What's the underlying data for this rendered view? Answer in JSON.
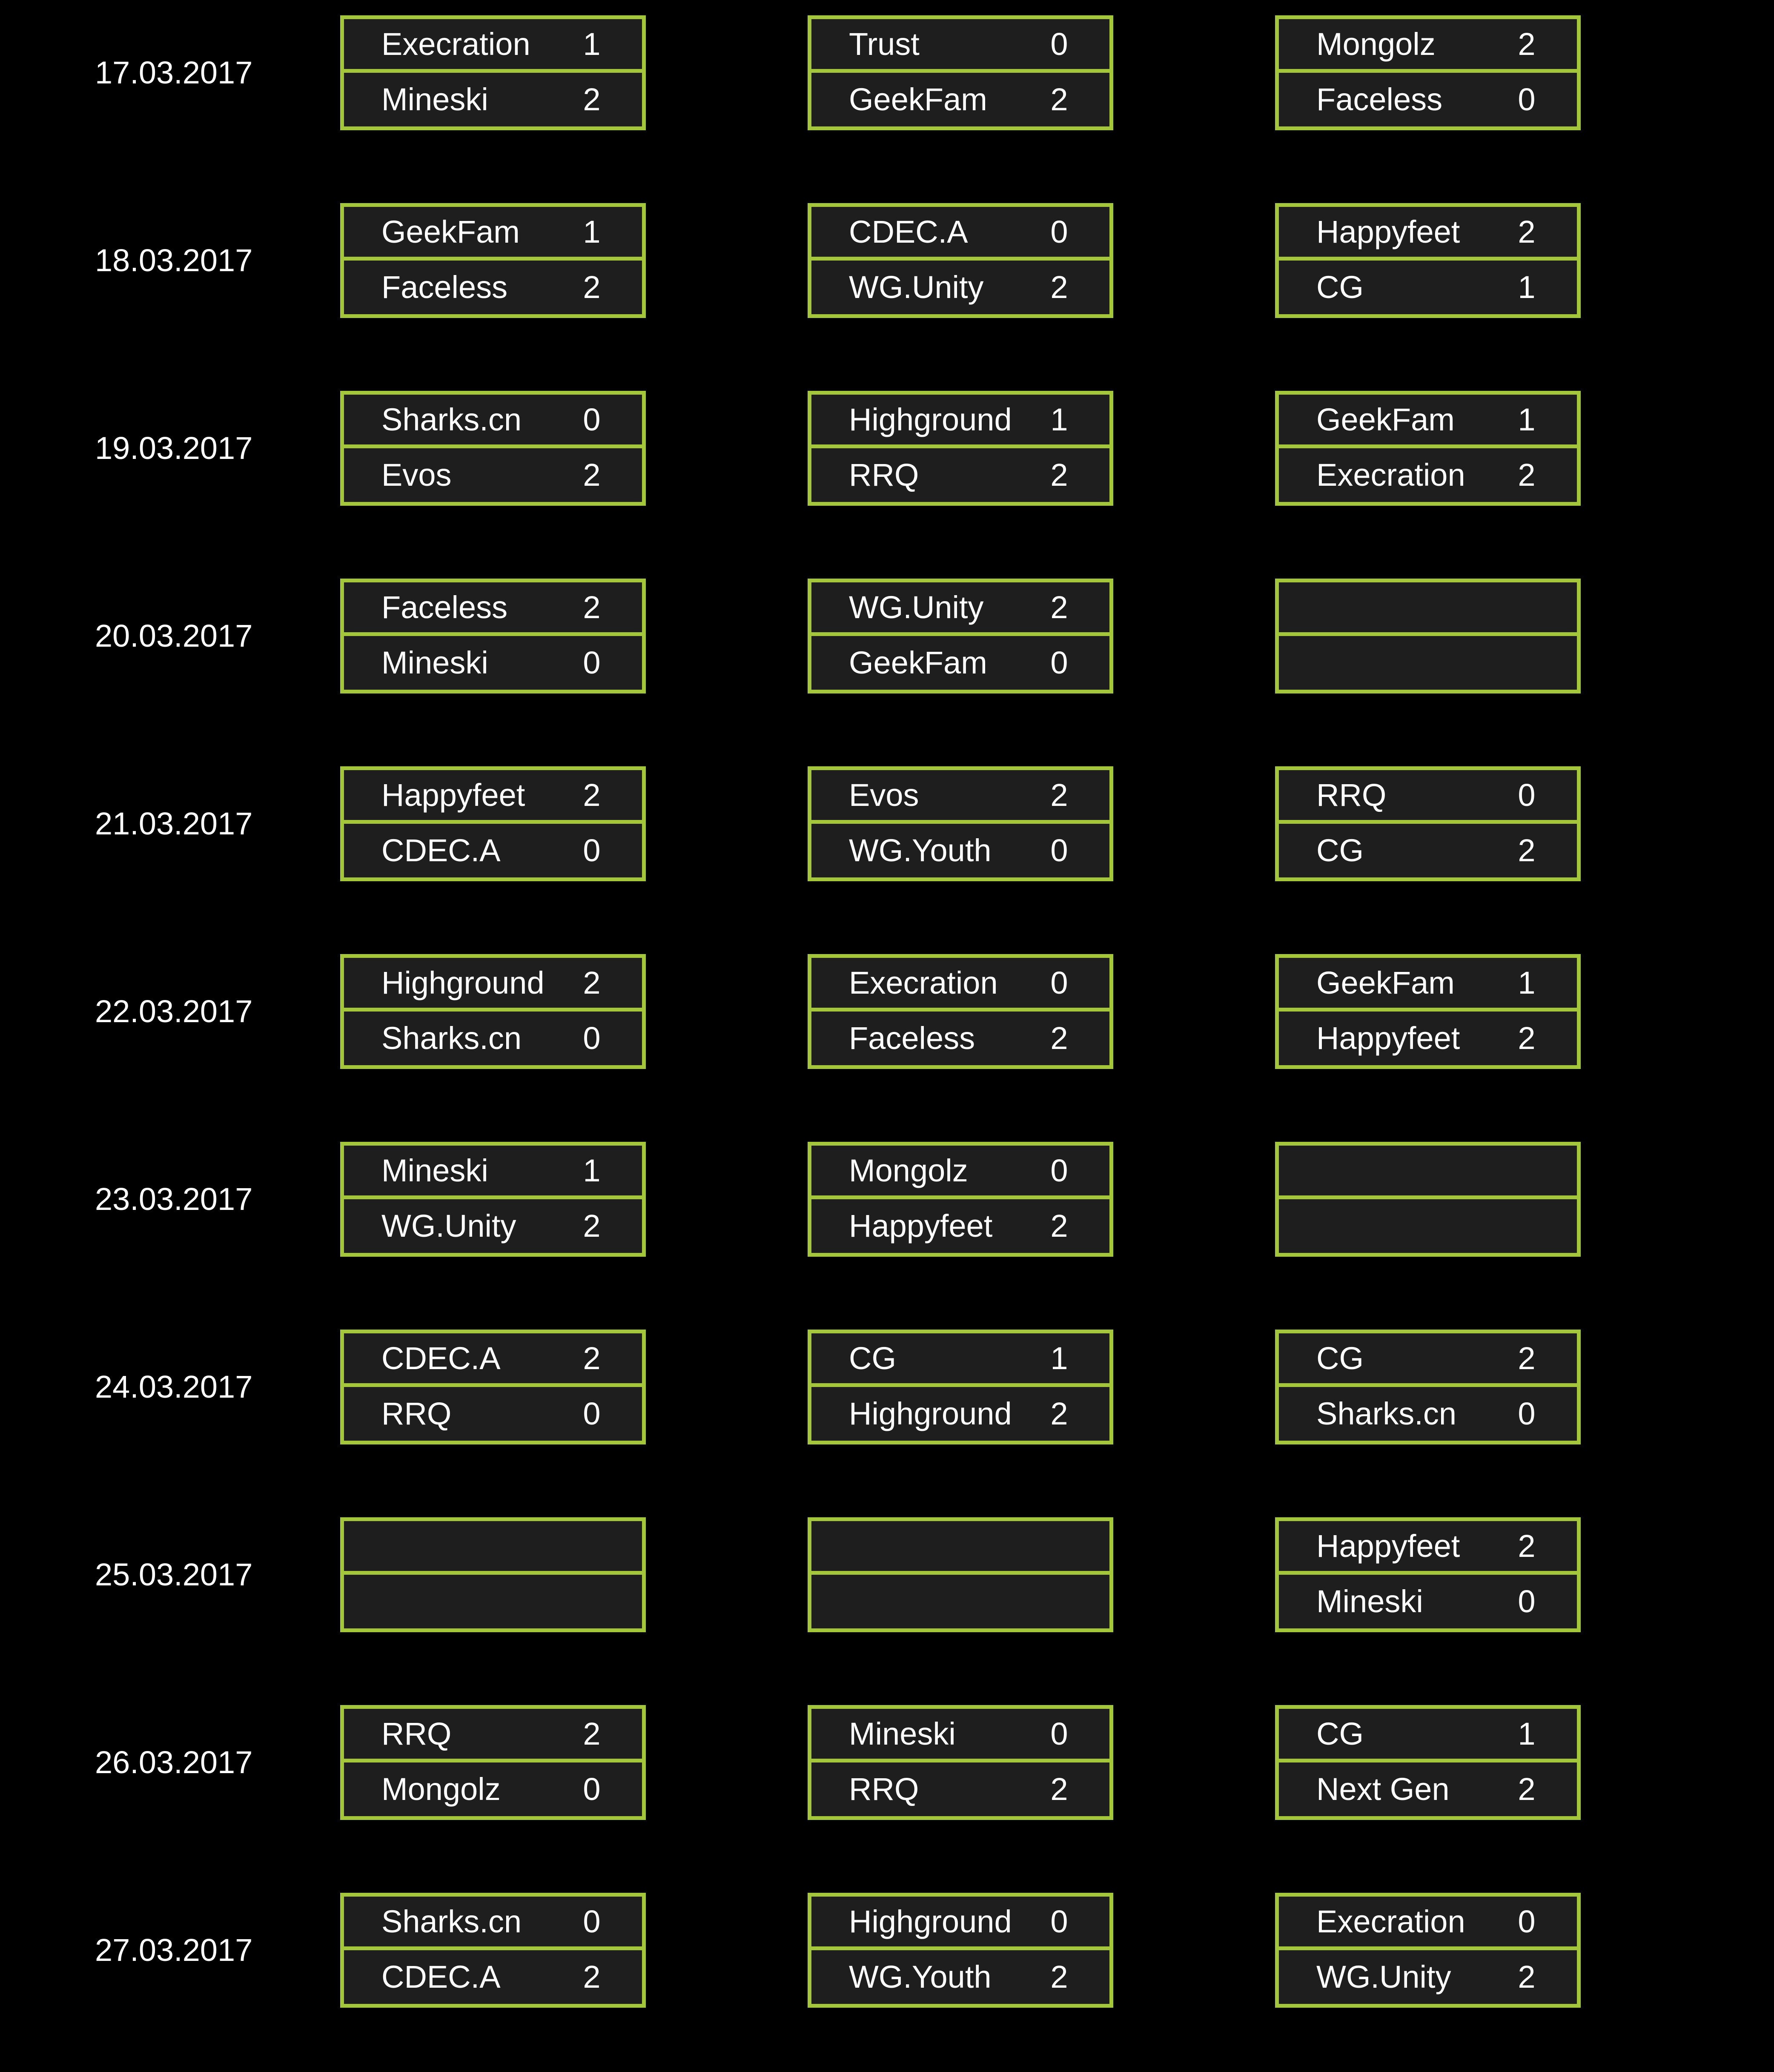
{
  "days": [
    {
      "date": "17.03.2017",
      "matches": [
        {
          "team1": "Execration",
          "score1": "1",
          "team2": "Mineski",
          "score2": "2"
        },
        {
          "team1": "Trust",
          "score1": "0",
          "team2": "GeekFam",
          "score2": "2"
        },
        {
          "team1": "Mongolz",
          "score1": "2",
          "team2": "Faceless",
          "score2": "0"
        }
      ]
    },
    {
      "date": "18.03.2017",
      "matches": [
        {
          "team1": "GeekFam",
          "score1": "1",
          "team2": "Faceless",
          "score2": "2"
        },
        {
          "team1": "CDEC.A",
          "score1": "0",
          "team2": "WG.Unity",
          "score2": "2"
        },
        {
          "team1": "Happyfeet",
          "score1": "2",
          "team2": "CG",
          "score2": "1"
        }
      ]
    },
    {
      "date": "19.03.2017",
      "matches": [
        {
          "team1": "Sharks.cn",
          "score1": "0",
          "team2": "Evos",
          "score2": "2"
        },
        {
          "team1": "Highground",
          "score1": "1",
          "team2": "RRQ",
          "score2": "2"
        },
        {
          "team1": "GeekFam",
          "score1": "1",
          "team2": "Execration",
          "score2": "2"
        }
      ]
    },
    {
      "date": "20.03.2017",
      "matches": [
        {
          "team1": "Faceless",
          "score1": "2",
          "team2": "Mineski",
          "score2": "0"
        },
        {
          "team1": "WG.Unity",
          "score1": "2",
          "team2": "GeekFam",
          "score2": "0"
        },
        {
          "team1": "",
          "score1": "",
          "team2": "",
          "score2": ""
        }
      ]
    },
    {
      "date": "21.03.2017",
      "matches": [
        {
          "team1": "Happyfeet",
          "score1": "2",
          "team2": "CDEC.A",
          "score2": "0"
        },
        {
          "team1": "Evos",
          "score1": "2",
          "team2": "WG.Youth",
          "score2": "0"
        },
        {
          "team1": "RRQ",
          "score1": "0",
          "team2": "CG",
          "score2": "2"
        }
      ]
    },
    {
      "date": "22.03.2017",
      "matches": [
        {
          "team1": "Highground",
          "score1": "2",
          "team2": "Sharks.cn",
          "score2": "0"
        },
        {
          "team1": "Execration",
          "score1": "0",
          "team2": "Faceless",
          "score2": "2"
        },
        {
          "team1": "GeekFam",
          "score1": "1",
          "team2": "Happyfeet",
          "score2": "2"
        }
      ]
    },
    {
      "date": "23.03.2017",
      "matches": [
        {
          "team1": "Mineski",
          "score1": "1",
          "team2": "WG.Unity",
          "score2": "2"
        },
        {
          "team1": "Mongolz",
          "score1": "0",
          "team2": "Happyfeet",
          "score2": "2"
        },
        {
          "team1": "",
          "score1": "",
          "team2": "",
          "score2": ""
        }
      ]
    },
    {
      "date": "24.03.2017",
      "matches": [
        {
          "team1": "CDEC.A",
          "score1": "2",
          "team2": "RRQ",
          "score2": "0"
        },
        {
          "team1": "CG",
          "score1": "1",
          "team2": "Highground",
          "score2": "2"
        },
        {
          "team1": "CG",
          "score1": "2",
          "team2": "Sharks.cn",
          "score2": "0"
        }
      ]
    },
    {
      "date": "25.03.2017",
      "matches": [
        {
          "team1": "",
          "score1": "",
          "team2": "",
          "score2": ""
        },
        {
          "team1": "",
          "score1": "",
          "team2": "",
          "score2": ""
        },
        {
          "team1": "Happyfeet",
          "score1": "2",
          "team2": "Mineski",
          "score2": "0"
        }
      ]
    },
    {
      "date": "26.03.2017",
      "matches": [
        {
          "team1": "RRQ",
          "score1": "2",
          "team2": "Mongolz",
          "score2": "0"
        },
        {
          "team1": "Mineski",
          "score1": "0",
          "team2": "RRQ",
          "score2": "2"
        },
        {
          "team1": "CG",
          "score1": "1",
          "team2": "Next Gen",
          "score2": "2"
        }
      ]
    },
    {
      "date": "27.03.2017",
      "matches": [
        {
          "team1": "Sharks.cn",
          "score1": "0",
          "team2": "CDEC.A",
          "score2": "2"
        },
        {
          "team1": "Highground",
          "score1": "0",
          "team2": "WG.Youth",
          "score2": "2"
        },
        {
          "team1": "Execration",
          "score1": "0",
          "team2": "WG.Unity",
          "score2": "2"
        }
      ]
    }
  ],
  "colors": {
    "background": "#000000",
    "box_fill": "#1e1e1e",
    "box_border": "#a3c63b",
    "text": "#ffffff"
  }
}
